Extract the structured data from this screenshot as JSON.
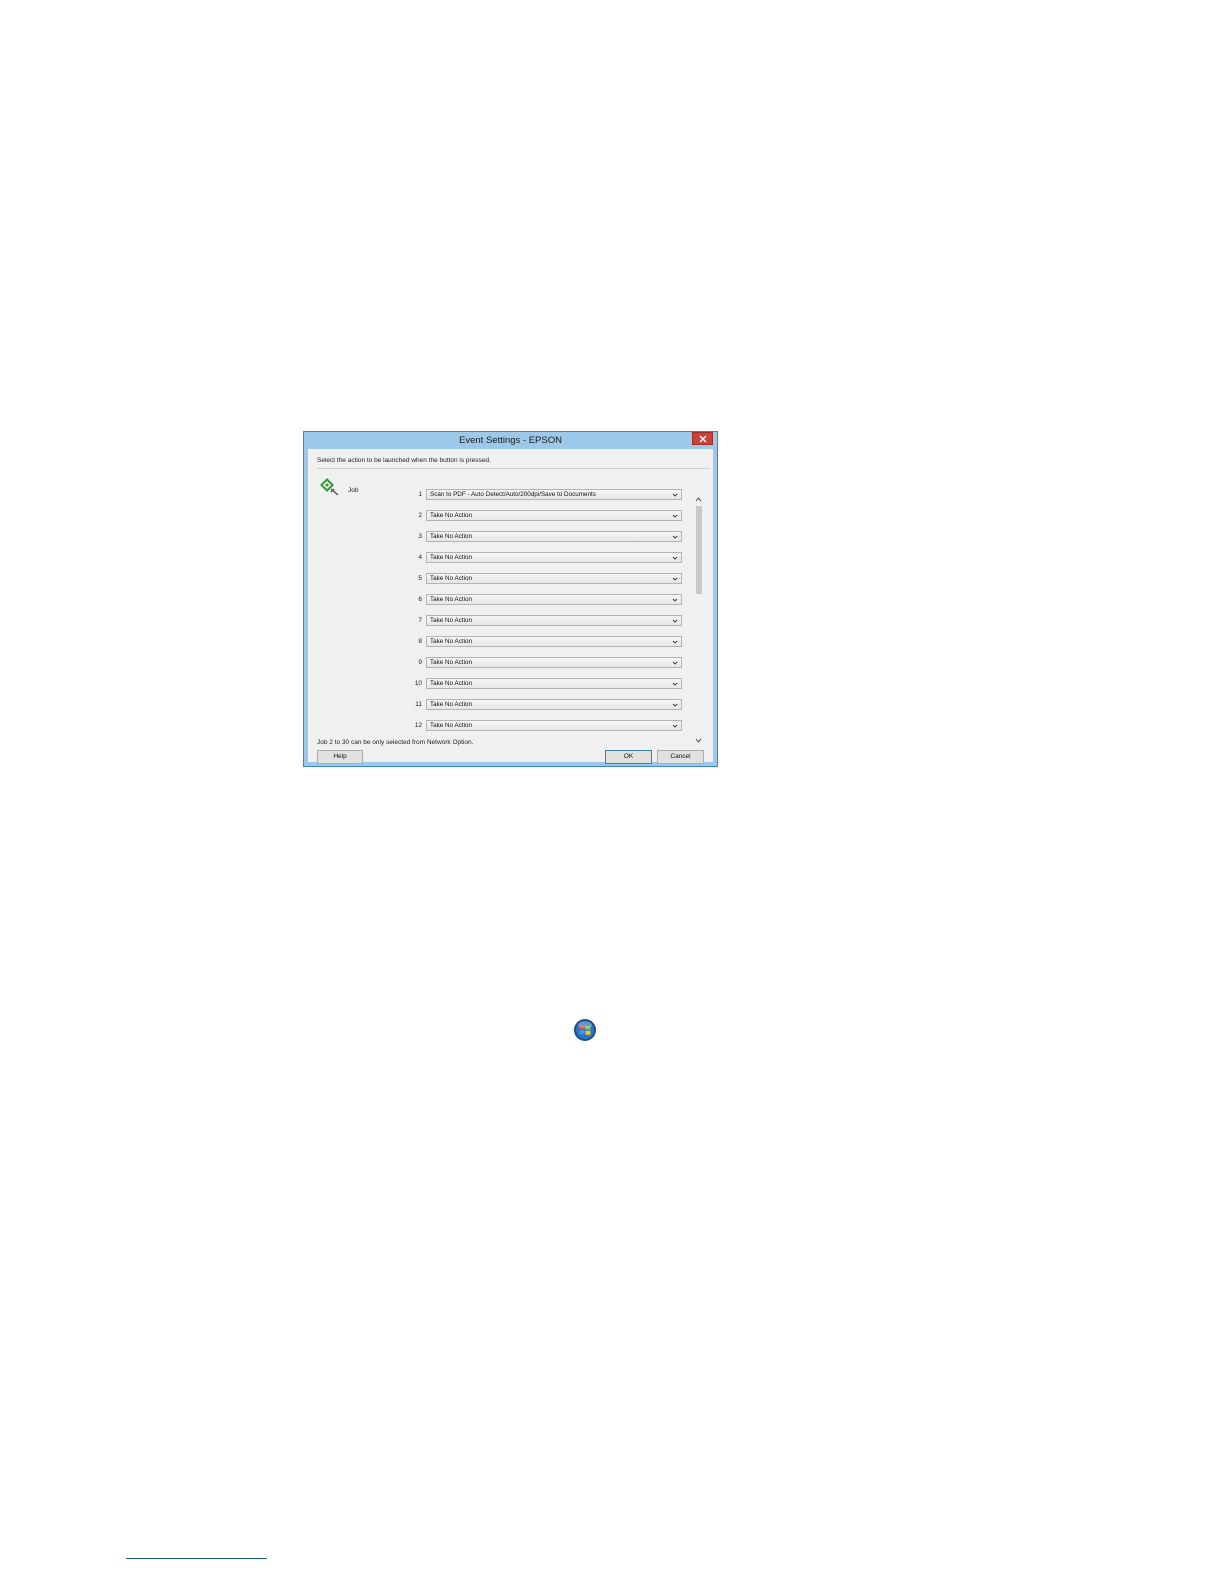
{
  "window": {
    "title": "Event Settings - EPSON",
    "close_icon": "close-icon"
  },
  "instruction": "Select the action to be launched when the button is pressed.",
  "job": {
    "icon": "epson-scan-icon",
    "label": "Job"
  },
  "jobs": [
    {
      "num": "1",
      "value": "Scan to PDF - Auto Detect/Auto/200dpi/Save to Documents"
    },
    {
      "num": "2",
      "value": "Take No Action"
    },
    {
      "num": "3",
      "value": "Take No Action"
    },
    {
      "num": "4",
      "value": "Take No Action"
    },
    {
      "num": "5",
      "value": "Take No Action"
    },
    {
      "num": "6",
      "value": "Take No Action"
    },
    {
      "num": "7",
      "value": "Take No Action"
    },
    {
      "num": "8",
      "value": "Take No Action"
    },
    {
      "num": "9",
      "value": "Take No Action"
    },
    {
      "num": "10",
      "value": "Take No Action"
    },
    {
      "num": "11",
      "value": "Take No Action"
    },
    {
      "num": "12",
      "value": "Take No Action"
    }
  ],
  "note": "Job 2 to 30 can be only selected from Network Option.",
  "buttons": {
    "help": "Help",
    "ok": "OK",
    "cancel": "Cancel"
  },
  "page": {
    "start_icon": "windows-start-orb-icon"
  },
  "colors": {
    "titlebar": "#9cc8ea",
    "close": "#c9423a",
    "client": "#f0f0f0",
    "icon_green": "#3a9a3a"
  }
}
